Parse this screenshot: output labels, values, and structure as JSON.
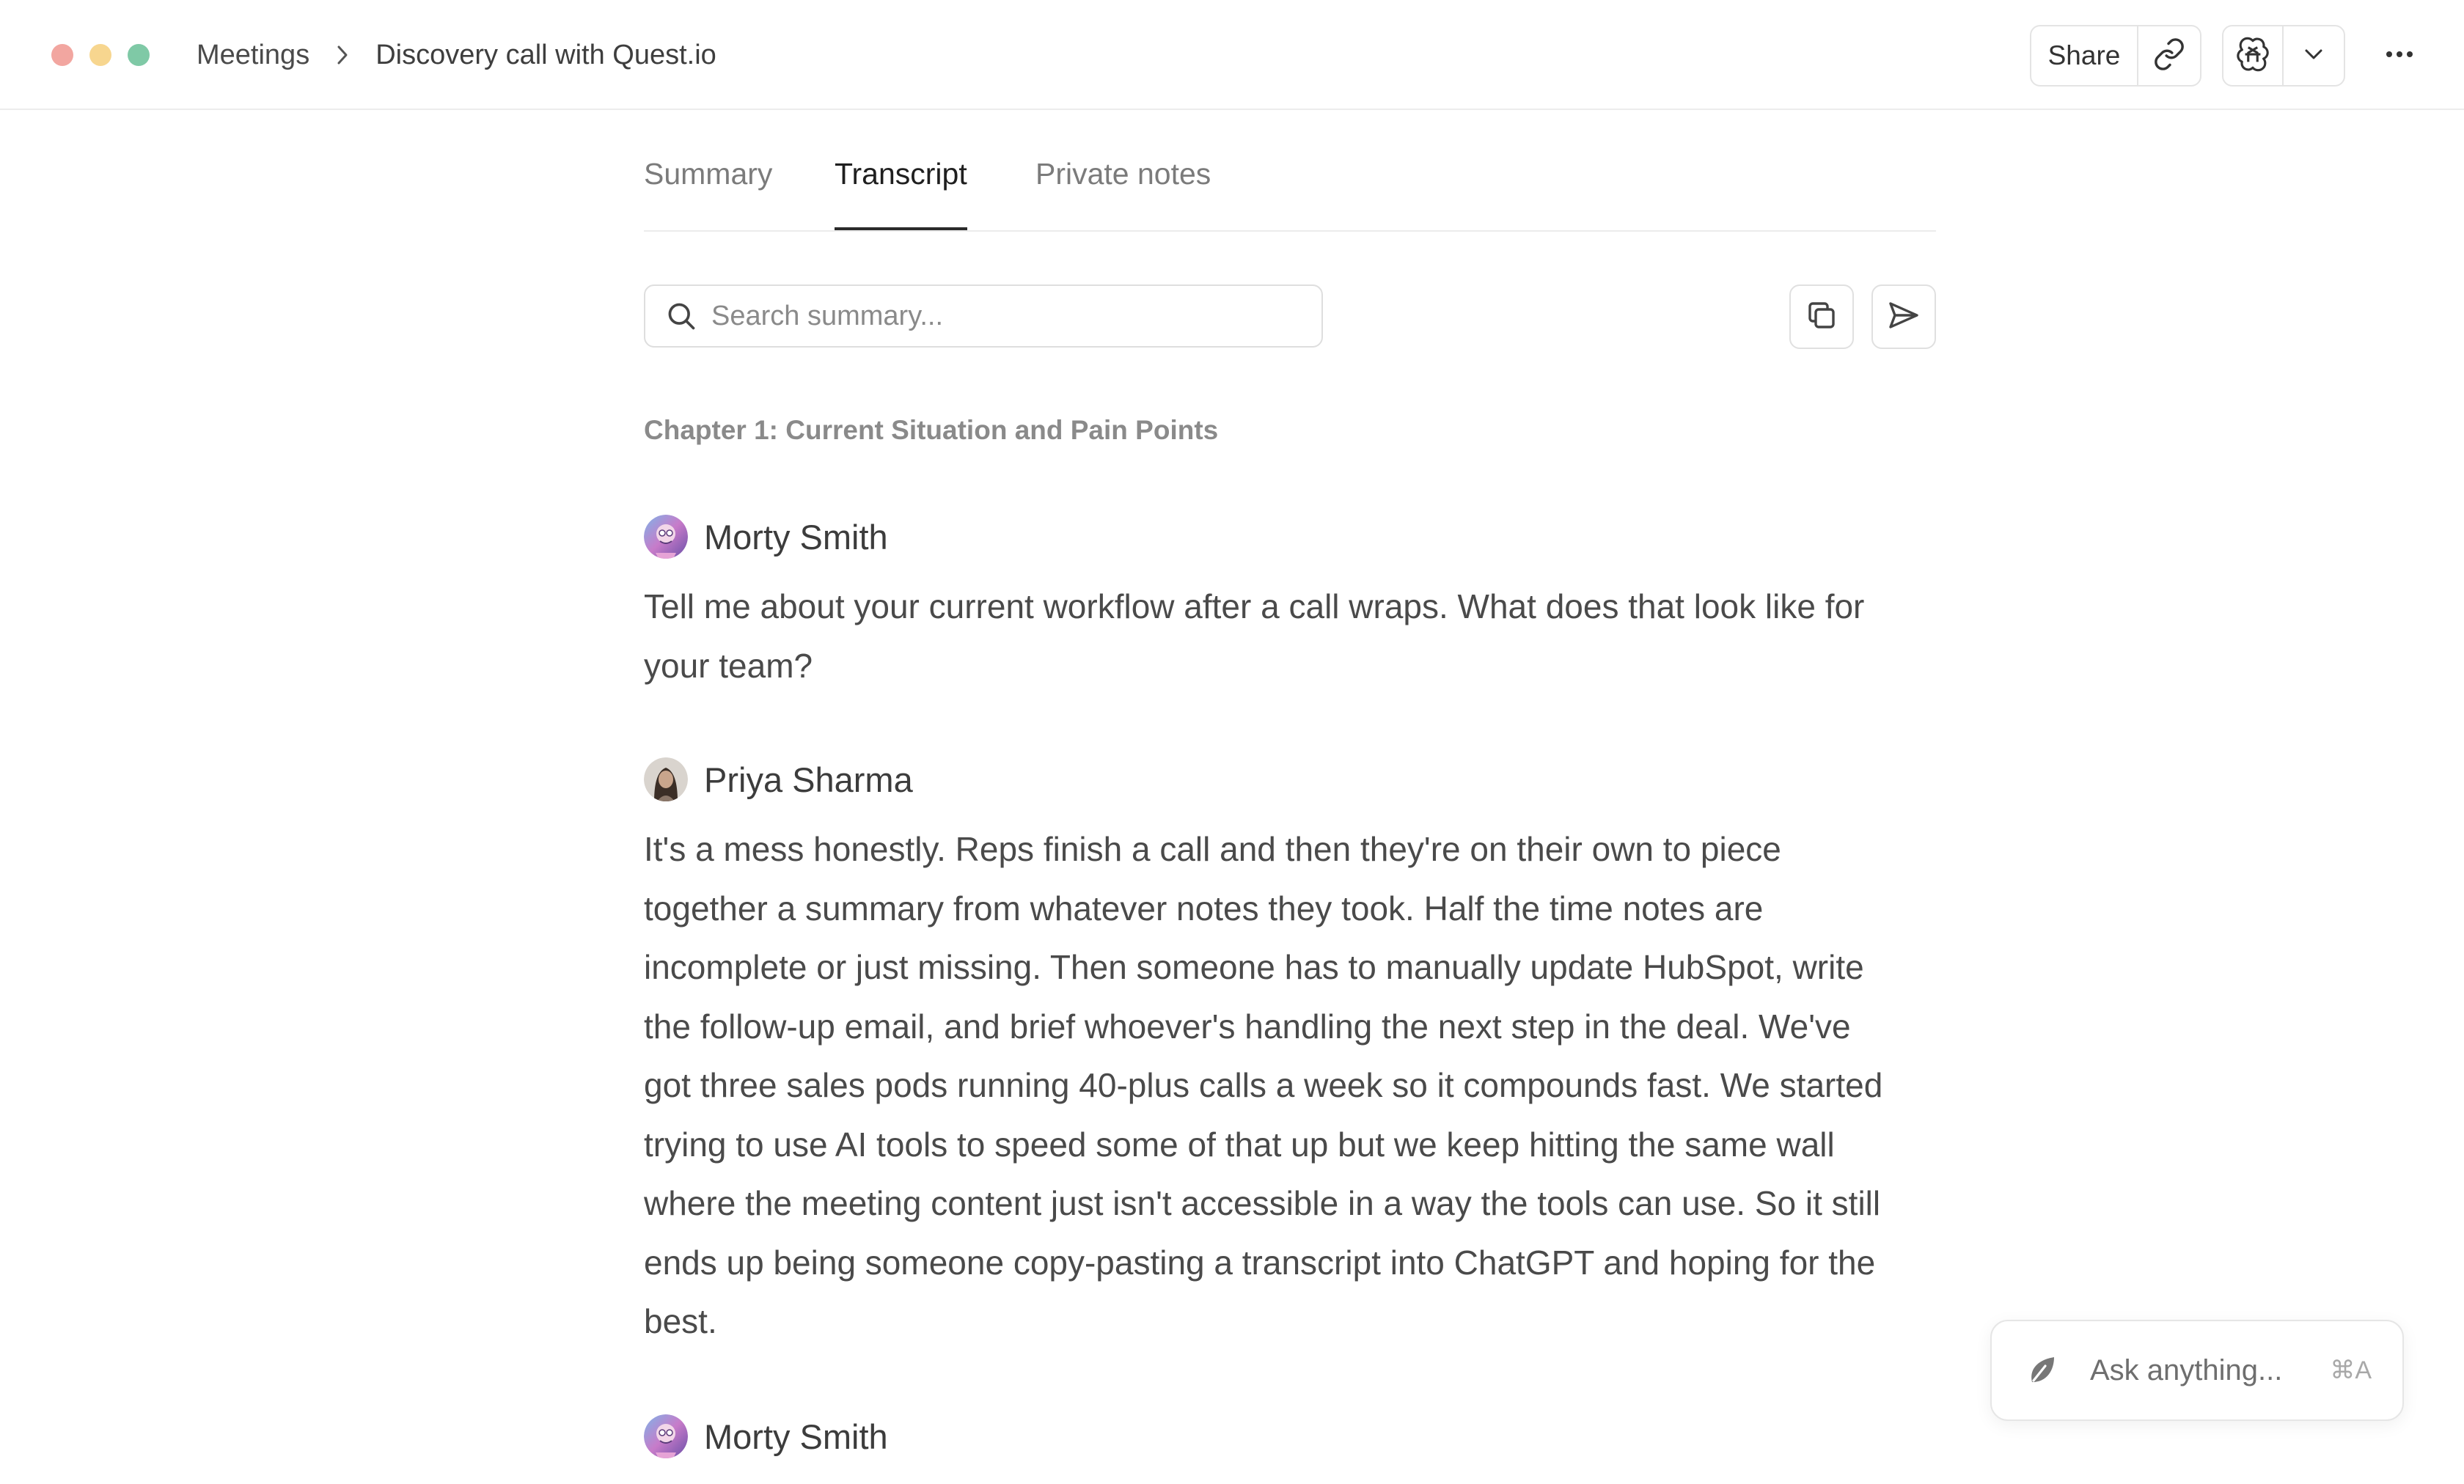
{
  "window": {
    "breadcrumb": {
      "parent": "Meetings",
      "current": "Discovery call with Quest.io"
    },
    "actions": {
      "share_label": "Share"
    }
  },
  "tabs": [
    {
      "label": "Summary",
      "active": false
    },
    {
      "label": "Transcript",
      "active": true
    },
    {
      "label": "Private notes",
      "active": false
    }
  ],
  "search": {
    "placeholder": "Search summary..."
  },
  "transcript": {
    "chapter": "Chapter 1: Current Situation and Pain Points",
    "entries": [
      {
        "speaker": "Morty Smith",
        "text": "Tell me about your current workflow after a call wraps. What does that look like for your team?"
      },
      {
        "speaker": "Priya Sharma",
        "text": "It's a mess honestly. Reps finish a call and then they're on their own to piece together a summary from whatever notes they took. Half the time notes are incomplete or just missing. Then someone has to manually update HubSpot, write the follow-up email, and brief whoever's handling the next step in the deal. We've got three sales pods running 40-plus calls a week so it compounds fast. We started trying to use AI tools to speed some of that up but we keep hitting the same wall where the meeting content just isn't accessible in a way the tools can use. So it still ends up being someone copy-pasting a transcript into ChatGPT and hoping for the best."
      },
      {
        "speaker": "Morty Smith",
        "text": ""
      }
    ]
  },
  "ask": {
    "placeholder": "Ask anything...",
    "shortcut": "⌘A"
  },
  "colors": {
    "traffic_red": "#f2a6a0",
    "traffic_yellow": "#f7d68f",
    "traffic_green": "#7fc9a6",
    "active_tab_underline": "#2a2a2a"
  },
  "icons": {
    "breadcrumb_separator": "chevron-right-icon",
    "link": "link-icon",
    "ai_model": "openai-icon",
    "dropdown": "chevron-down-icon",
    "more": "more-horizontal-icon",
    "search": "search-icon",
    "copy": "copy-icon",
    "send": "send-icon",
    "ask": "leaf-icon"
  }
}
